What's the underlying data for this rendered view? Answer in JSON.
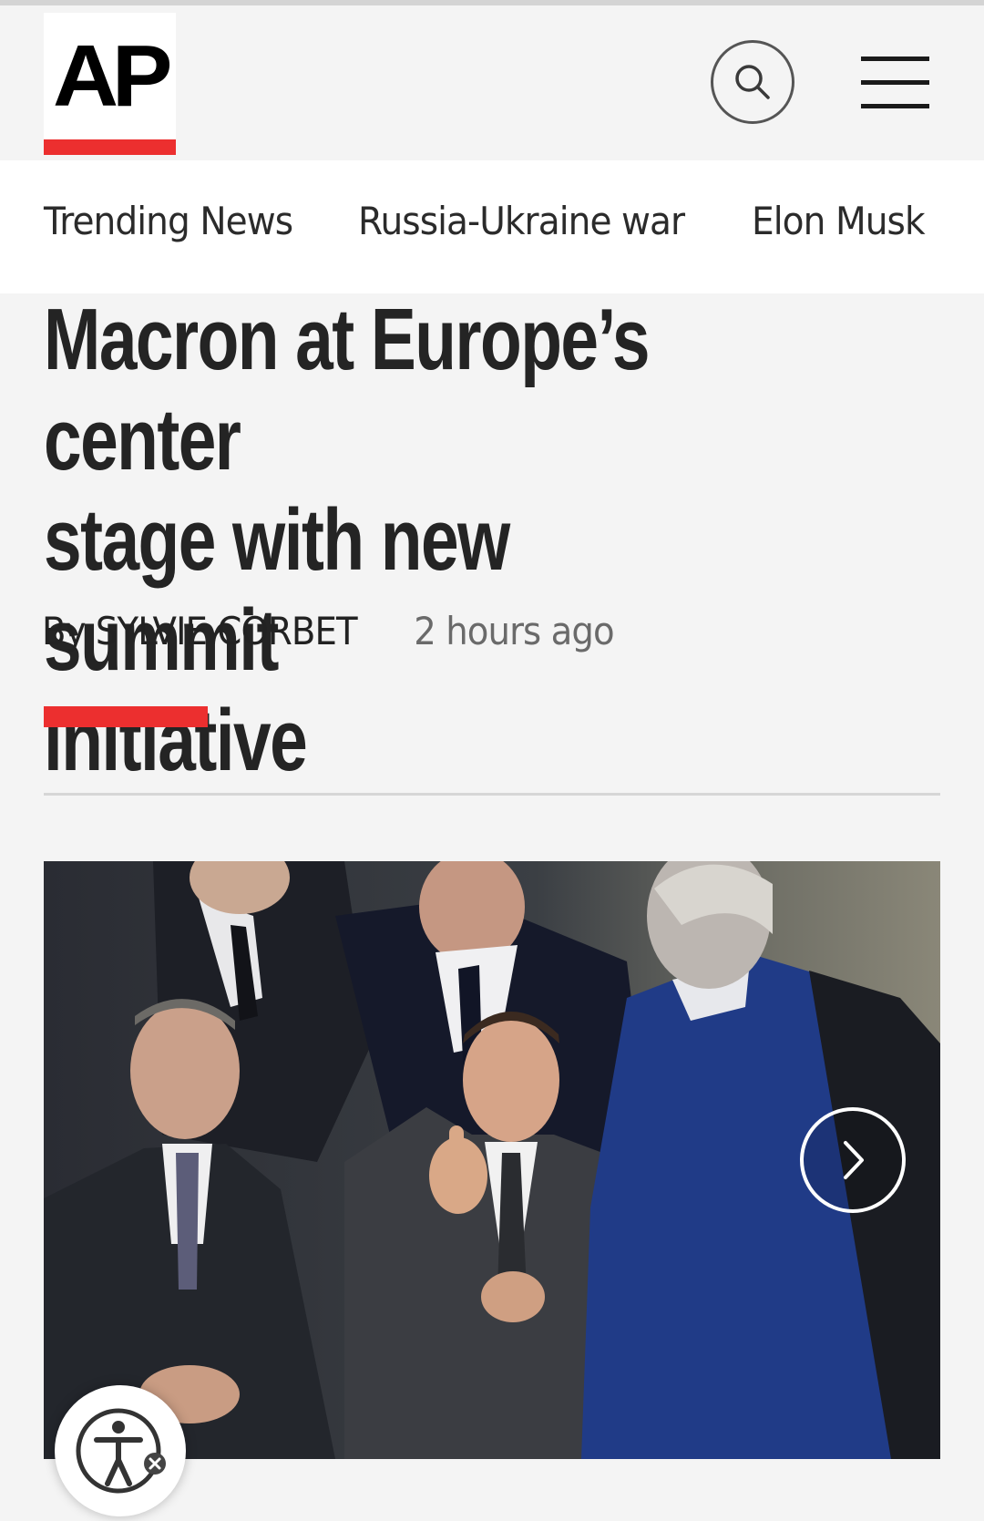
{
  "header": {
    "logo_text": "AP",
    "search_icon": "search-icon",
    "menu_icon": "hamburger-menu-icon",
    "accent_color": "#ec2f2f"
  },
  "trending": {
    "items": [
      {
        "label": "Trending News"
      },
      {
        "label": "Russia-Ukraine war"
      },
      {
        "label": "Elon Musk"
      }
    ]
  },
  "article": {
    "headline_lines": [
      "Macron at Europe’s center",
      "stage with new summit",
      "initiative"
    ],
    "byline": "By SYLVIE CORBET",
    "time": "2 hours ago",
    "photo": {
      "next_icon": "chevron-right-icon"
    }
  },
  "accessibility": {
    "icon": "accessibility-icon",
    "close_icon": "close-icon"
  }
}
